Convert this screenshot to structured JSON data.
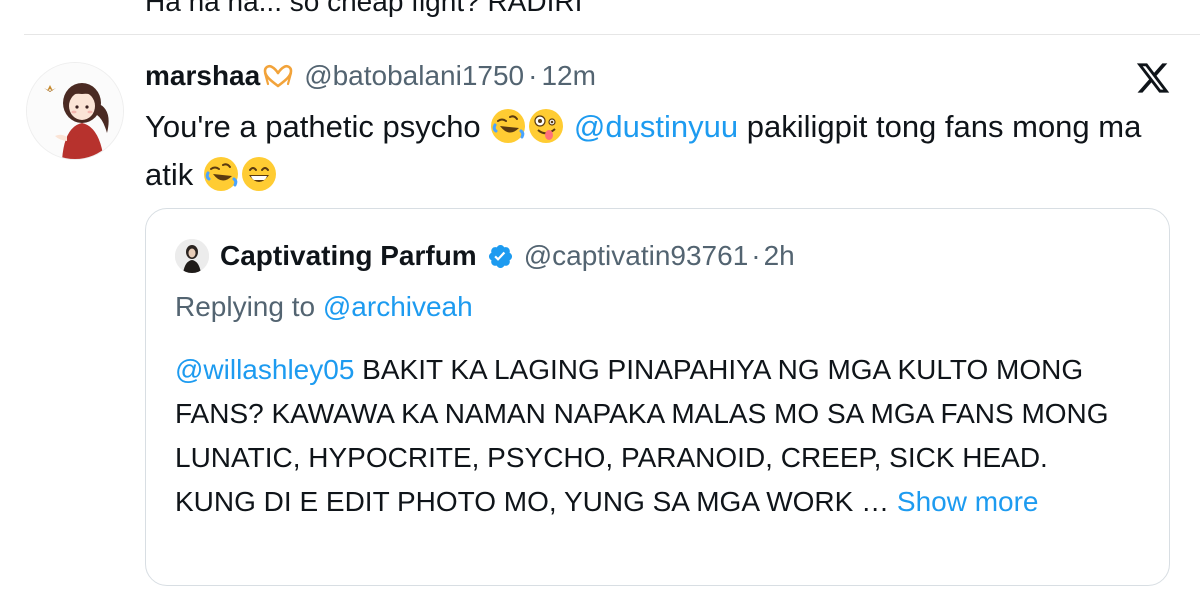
{
  "previous_tweet": {
    "text": "Ha ha ha... so cheap fight? RADIRI"
  },
  "tweet": {
    "display_name": "marshaa",
    "name_emoji": "heart-hands-icon",
    "handle": "@batobalani1750",
    "separator": "·",
    "time": "12m",
    "text_part1": "You're a pathetic psycho ",
    "mention": "@dustinyuu",
    "text_part2": " pakiligpit tong fans mong ma atik ",
    "emojis": [
      "rofl-emoji",
      "zany-face-emoji",
      "rofl-emoji",
      "grinning-face-emoji"
    ]
  },
  "quoted_tweet": {
    "display_name": "Captivating Parfum",
    "verified": true,
    "handle": "@captivatin93761",
    "separator": "·",
    "time": "2h",
    "replying_label": "Replying to ",
    "replying_to": "@archiveah",
    "mention": "@willashley05",
    "body_line1": " BAKIT KA LAGING PINAPAHIYA NG MGA KULTO MONG FANS? KAWAWA KA NAMAN NAPAKA MALAS MO SA MGA FANS MONG LUNATIC, HYPOCRITE, PSYCHO, PARANOID, CREEP, SICK HEAD.",
    "body_line2": "KUNG DI E EDIT PHOTO MO, YUNG SA MGA WORK … ",
    "show_more": "Show more"
  },
  "colors": {
    "link": "#1d9bf0",
    "secondary_text": "#536471",
    "primary_text": "#0f1419",
    "border": "#d8dee3",
    "verified": "#1d9bf0"
  }
}
